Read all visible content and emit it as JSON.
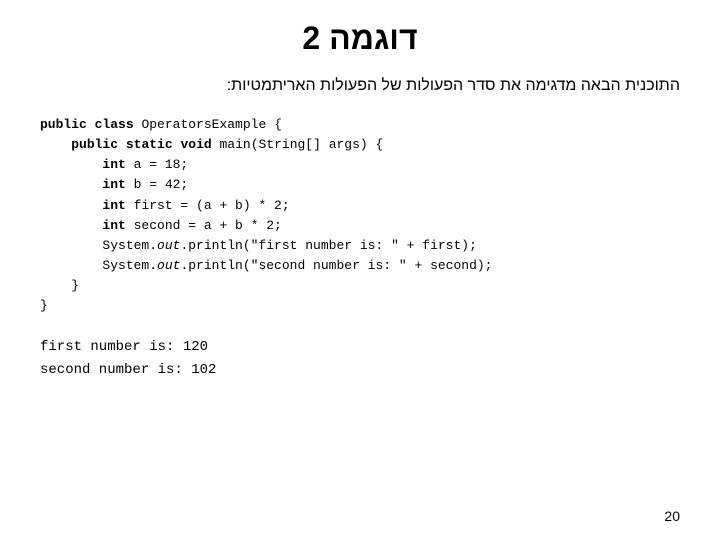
{
  "title": "דוגמה 2",
  "subtitle": "התוכנית הבאה מדגימה את סדר הפעולות של הפעולות האריתמטיות:",
  "code": {
    "line1": "public class OperatorsExample {",
    "line2": "    public static void main(String[] args) {",
    "line3": "        int a = 18;",
    "line4": "        int b = 42;",
    "line5": "        int first = (a + b) * 2;",
    "line6": "        int second = a + b * 2;",
    "line7": "        System.out.println(\"first number is: \" + first);",
    "line8": "        System.out.println(\"second number is: \" + second);",
    "line9": "    }",
    "line10": "}"
  },
  "output": {
    "line1": "first number is: 120",
    "line2": "second number is: 102"
  },
  "page_number": "20"
}
